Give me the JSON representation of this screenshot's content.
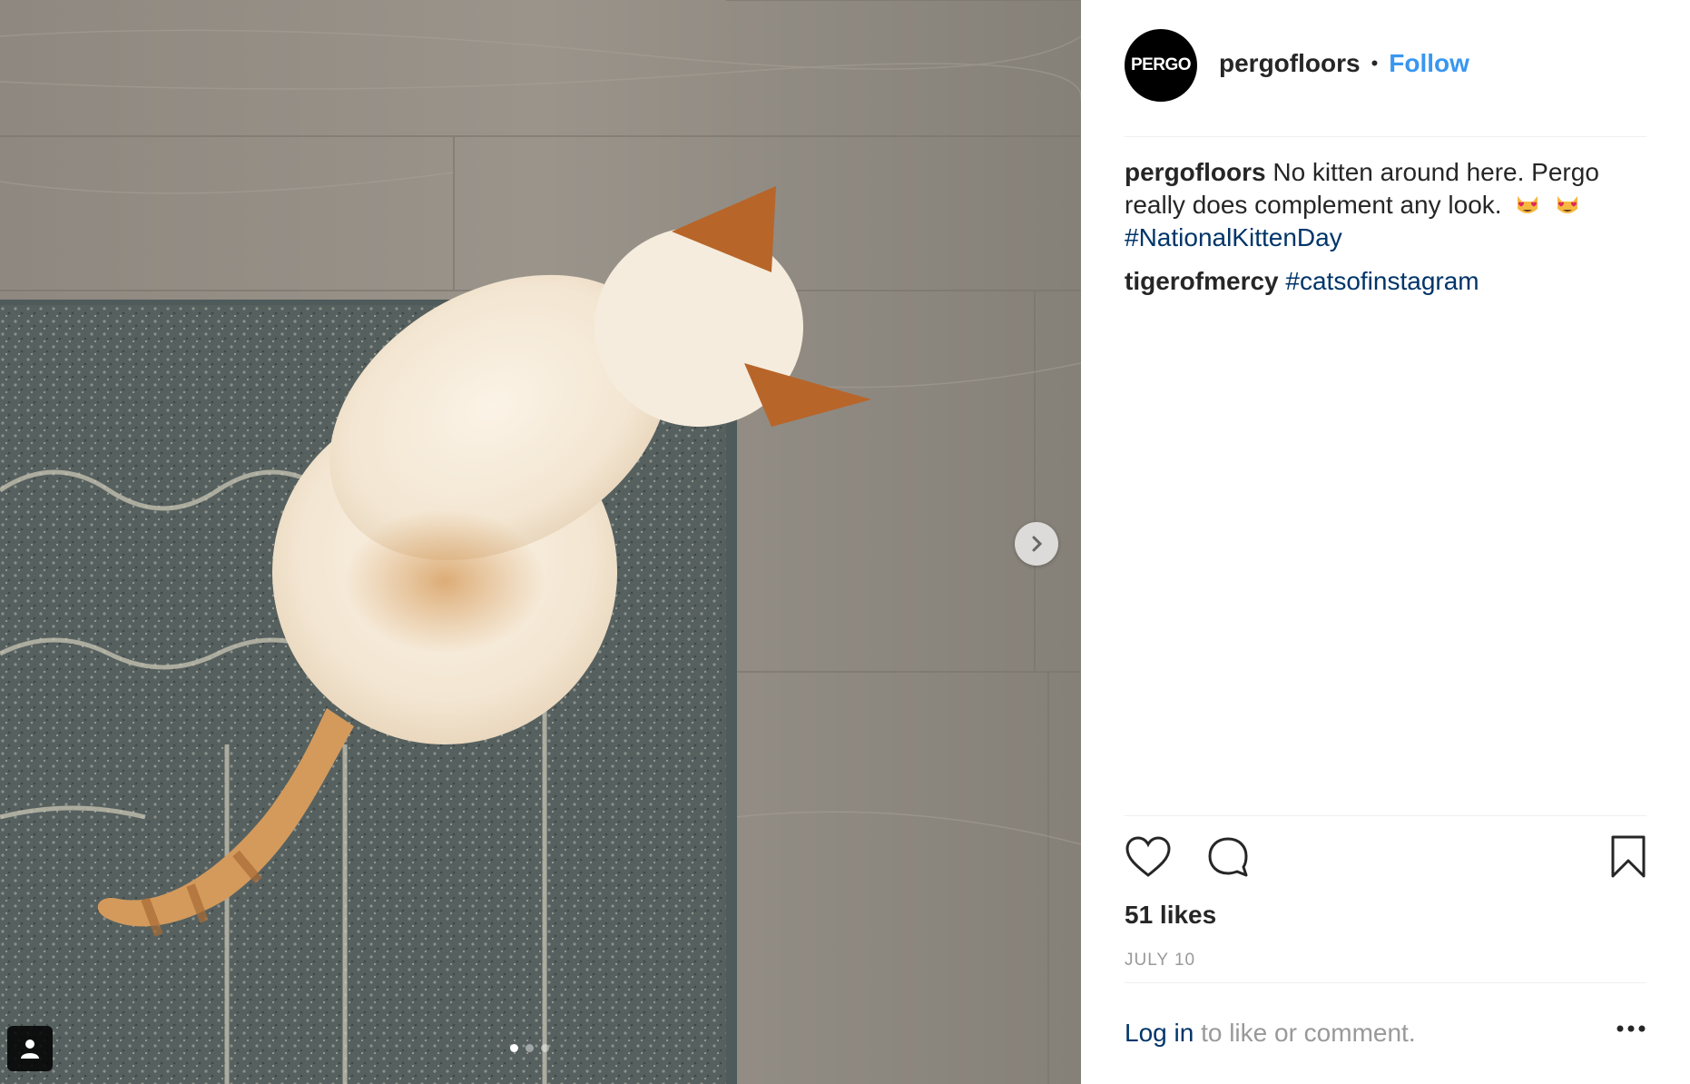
{
  "post": {
    "image_alt": "Cat sitting on rug over Pergo floor",
    "carousel": {
      "count": 3,
      "active": 1
    }
  },
  "header": {
    "avatar_text": "PERGO",
    "username": "pergofloors",
    "separator": "•",
    "follow_label": "Follow"
  },
  "comments": [
    {
      "user": "pergofloors",
      "text": "No kitten around here. Pergo really does complement any look.",
      "emojis": [
        "heart-eyes-cat",
        "heart-eyes-cat"
      ],
      "hashtag": "#NationalKittenDay"
    },
    {
      "user": "tigerofmercy",
      "hashtag": "#catsofinstagram"
    }
  ],
  "actions": {
    "icons": [
      "heart-icon",
      "comment-icon",
      "bookmark-icon"
    ]
  },
  "likes": "51 likes",
  "date": "JULY 10",
  "footer": {
    "login_link": "Log in",
    "login_text": "to like or comment.",
    "more_icon": "ellipsis-icon"
  },
  "colors": {
    "follow": "#3897f0",
    "hashtag": "#003569",
    "muted": "#999999",
    "text": "#262626"
  }
}
